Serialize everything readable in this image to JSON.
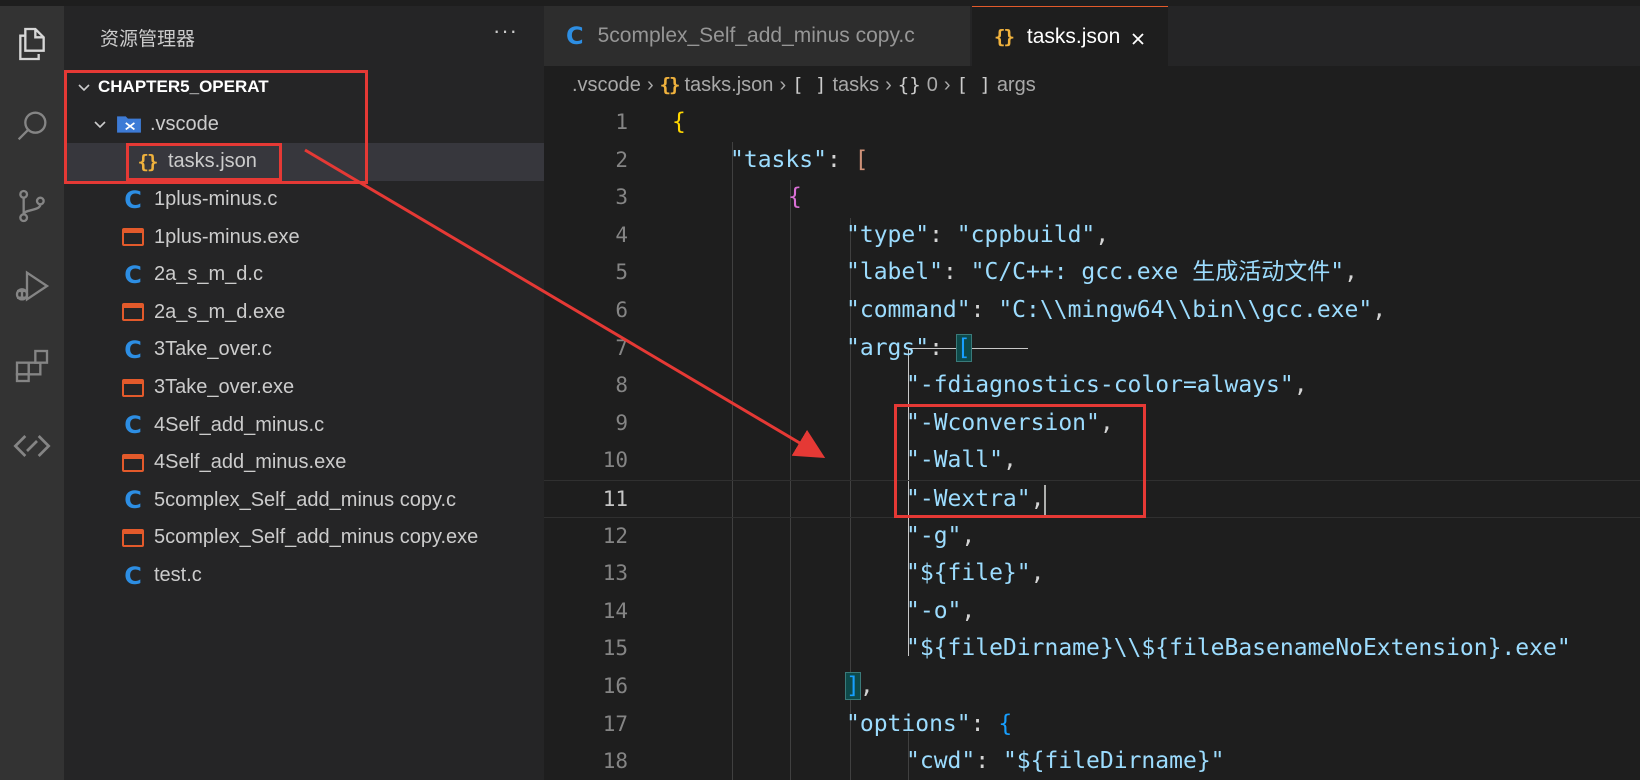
{
  "sidebar": {
    "title": "资源管理器",
    "more": "···",
    "project": "CHAPTER5_OPERAT",
    "folder": ".vscode",
    "files": [
      {
        "name": "tasks.json",
        "type": "json"
      },
      {
        "name": "1plus-minus.c",
        "type": "c"
      },
      {
        "name": "1plus-minus.exe",
        "type": "exe"
      },
      {
        "name": "2a_s_m_d.c",
        "type": "c"
      },
      {
        "name": "2a_s_m_d.exe",
        "type": "exe"
      },
      {
        "name": "3Take_over.c",
        "type": "c"
      },
      {
        "name": "3Take_over.exe",
        "type": "exe"
      },
      {
        "name": "4Self_add_minus.c",
        "type": "c"
      },
      {
        "name": "4Self_add_minus.exe",
        "type": "exe"
      },
      {
        "name": "5complex_Self_add_minus copy.c",
        "type": "c"
      },
      {
        "name": "5complex_Self_add_minus copy.exe",
        "type": "exe"
      },
      {
        "name": "test.c",
        "type": "c"
      }
    ]
  },
  "tabs": [
    {
      "label": "5complex_Self_add_minus copy.c",
      "icon": "C",
      "active": false
    },
    {
      "label": "tasks.json",
      "icon": "{}",
      "active": true
    }
  ],
  "breadcrumb": {
    "root": ".vscode",
    "file_icon": "{}",
    "file": "tasks.json",
    "tasks_icon": "[ ]",
    "tasks": "tasks",
    "item_icon": "{}",
    "item": "0",
    "args_icon": "[ ]",
    "args": "args"
  },
  "editor": {
    "line_numbers": [
      "1",
      "2",
      "3",
      "4",
      "5",
      "6",
      "7",
      "8",
      "9",
      "10",
      "11",
      "12",
      "13",
      "14",
      "15",
      "16",
      "17",
      "18"
    ],
    "current_line": "11",
    "lines": {
      "l1": "{",
      "l2_key": "\"tasks\"",
      "l2_rest": ": ",
      "l2_br": "[",
      "l3": "{",
      "l4_key": "\"type\"",
      "l4_val": "\"cppbuild\"",
      "l5_key": "\"label\"",
      "l5_val": "\"C/C++: gcc.exe 生成活动文件\"",
      "l6_key": "\"command\"",
      "l6_val": "\"C:\\\\mingw64\\\\bin\\\\gcc.exe\"",
      "l7_key": "\"args\"",
      "l7_br": "[",
      "l8": "\"-fdiagnostics-color=always\"",
      "l9": "\"-Wconversion\"",
      "l10": "\"-Wall\"",
      "l11": "\"-Wextra\"",
      "l12": "\"-g\"",
      "l13": "\"${file}\"",
      "l14": "\"-o\"",
      "l15": "\"${fileDirname}\\\\${fileBasenameNoExtension}.exe\"",
      "l16_br": "]",
      "l17_key": "\"options\"",
      "l17_br": "{",
      "l18_key": "\"cwd\"",
      "l18_val": "\"${fileDirname}\""
    }
  },
  "colors": {
    "annotation_red": "#e53935",
    "key_blue": "#9cdcfe",
    "string_orange": "#ce9178"
  }
}
